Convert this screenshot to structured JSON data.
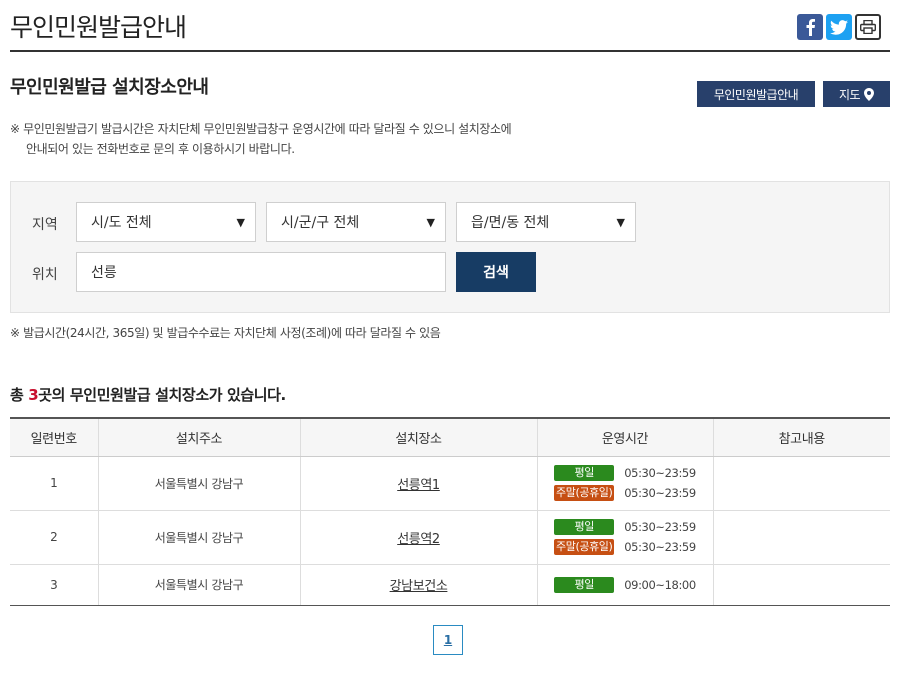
{
  "header": {
    "title": "무인민원발급안내",
    "share": {
      "facebook": "facebook-icon",
      "twitter": "twitter-icon",
      "print": "print-icon"
    }
  },
  "section": {
    "title": "무인민원발급 설치장소안내",
    "guide_button": "무인민원발급안내",
    "map_button": "지도",
    "map_icon": "map-pin-icon"
  },
  "notice_top": {
    "line1": "※ 무인민원발급기 발급시간은 자치단체 무인민원발급창구 운영시간에 따라 달라질 수 있으니 설치장소에",
    "line2": "안내되어 있는 전화번호로 문의 후 이용하시기 바랍니다."
  },
  "search": {
    "region_label": "지역",
    "sido": "시/도 전체",
    "sigungu": "시/군/구 전체",
    "eupmyeondong": "읍/면/동 전체",
    "location_label": "위치",
    "location_value": "선릉",
    "search_button": "검색"
  },
  "notice_bottom": "※ 발급시간(24시간, 365일) 및 발급수수료는 자치단체 사정(조례)에 따라 달라질 수 있음",
  "results": {
    "prefix": "총 ",
    "count": "3",
    "suffix": "곳의 무인민원발급 설치장소가 있습니다."
  },
  "table": {
    "headers": [
      "일련번호",
      "설치주소",
      "설치장소",
      "운영시간",
      "참고내용"
    ],
    "weekday_label": "평일",
    "weekend_label": "주말(공휴일)",
    "rows": [
      {
        "no": "1",
        "address": "서울특별시 강남구",
        "place": "선릉역1",
        "weekday": "05:30~23:59",
        "weekend": "05:30~23:59",
        "note": ""
      },
      {
        "no": "2",
        "address": "서울특별시 강남구",
        "place": "선릉역2",
        "weekday": "05:30~23:59",
        "weekend": "05:30~23:59",
        "note": ""
      },
      {
        "no": "3",
        "address": "서울특별시 강남구",
        "place": "강남보건소",
        "weekday": "09:00~18:00",
        "note": ""
      }
    ]
  },
  "pagination": {
    "current": "1"
  },
  "colors": {
    "navy_button": "#28406b",
    "search_button": "#173c64",
    "weekday_badge": "#2b8a1e",
    "weekend_badge": "#c64f13",
    "count_highlight": "#c8102e"
  }
}
